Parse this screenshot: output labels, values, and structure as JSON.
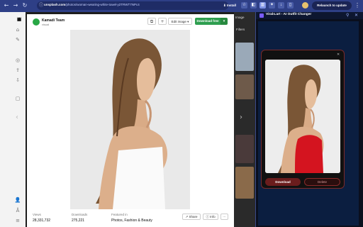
{
  "browser": {
    "url_domain": "unsplash.com",
    "url_path": "/photos/woman-wearing-white-towel-y2TRWT7NPc4",
    "install_label": "Install",
    "relaunch_label": "Relaunch to update",
    "icons": [
      "back-icon",
      "forward-icon",
      "reload-icon",
      "info-icon",
      "star-icon"
    ]
  },
  "photo_modal": {
    "author_name": "Kamadi Team",
    "author_handle": "visual",
    "edit_image_label": "Edit image",
    "download_label": "Download free",
    "stats": {
      "views_label": "Views",
      "views_value": "28,331,732",
      "downloads_label": "Downloads",
      "downloads_value": "275,221",
      "featured_label": "Featured in",
      "featured_value": "Photos, Fashion & Beauty"
    },
    "share_label": "Share",
    "info_label": "Info",
    "more_label": "···"
  },
  "background_page": {
    "strip_label": "Image",
    "filters_label": "Filters"
  },
  "extension": {
    "title": "Virals.art - AI Outfit Changer",
    "download_label": "Download",
    "delete_label": "Delete",
    "accent_color": "#c0202a"
  }
}
